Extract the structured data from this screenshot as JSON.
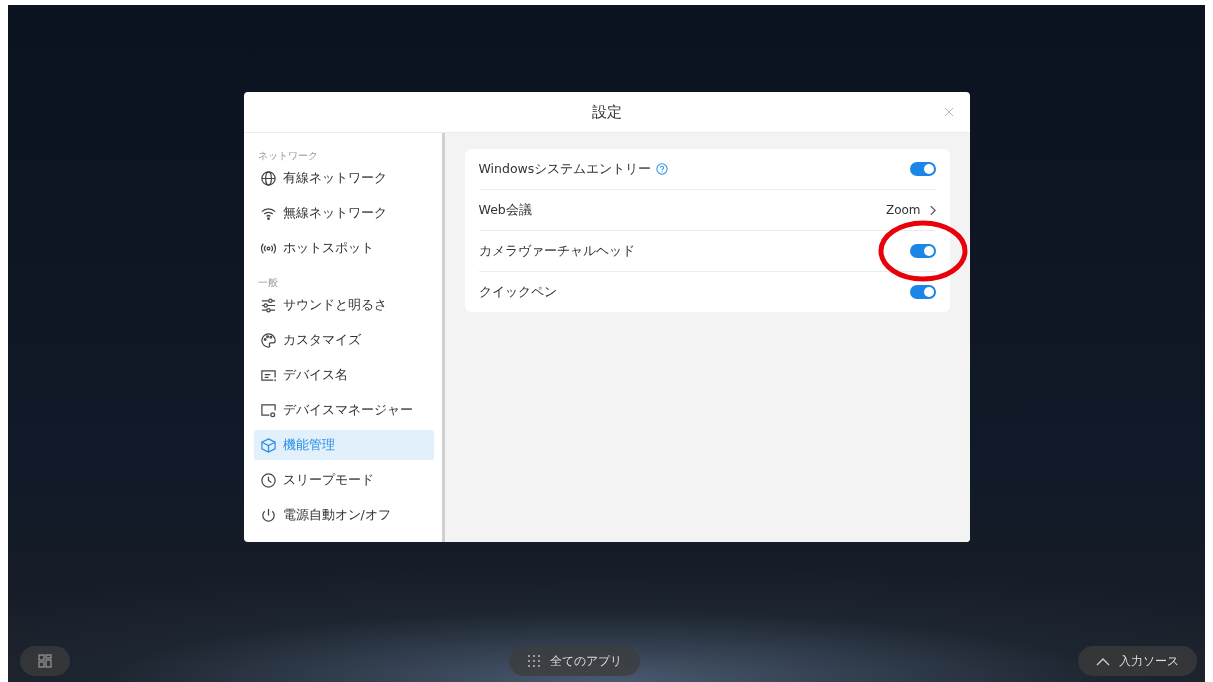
{
  "dialog": {
    "title": "設定"
  },
  "sidebar": {
    "sections": [
      {
        "label": "ネットワーク",
        "items": [
          {
            "label": "有線ネットワーク",
            "selected": false
          },
          {
            "label": "無線ネットワーク",
            "selected": false
          },
          {
            "label": "ホットスポット",
            "selected": false
          }
        ]
      },
      {
        "label": "一般",
        "items": [
          {
            "label": "サウンドと明るさ",
            "selected": false
          },
          {
            "label": "カスタマイズ",
            "selected": false
          },
          {
            "label": "デバイス名",
            "selected": false
          },
          {
            "label": "デバイスマネージャー",
            "selected": false
          },
          {
            "label": "機能管理",
            "selected": true
          },
          {
            "label": "スリープモード",
            "selected": false
          },
          {
            "label": "電源自動オン/オフ",
            "selected": false
          }
        ]
      }
    ]
  },
  "settings": [
    {
      "kind": "toggle",
      "label": "Windowsシステムエントリー",
      "help": true,
      "on": true,
      "highlighted": false
    },
    {
      "kind": "link",
      "label": "Web会議",
      "value": "Zoom"
    },
    {
      "kind": "toggle",
      "label": "カメラヴァーチャルヘッド",
      "help": false,
      "on": true,
      "highlighted": true
    },
    {
      "kind": "toggle",
      "label": "クイックペン",
      "help": false,
      "on": true,
      "highlighted": false
    }
  ],
  "dock": {
    "all_apps": "全てのアプリ",
    "input_source": "入力ソース"
  }
}
